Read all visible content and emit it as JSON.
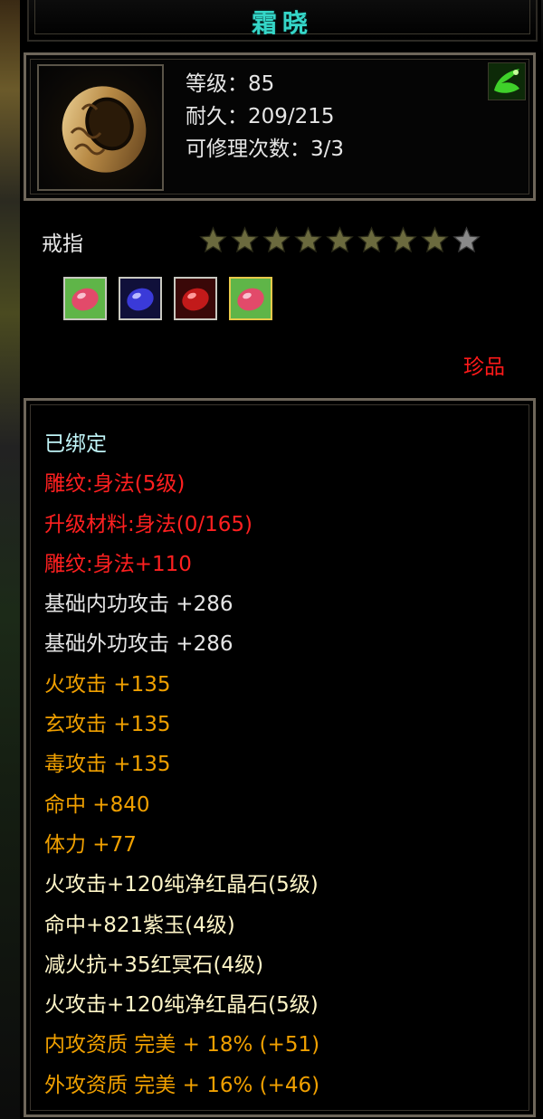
{
  "title": "霜晓",
  "header": {
    "level_label": "等级：85",
    "durability_label": "耐久：209/215",
    "repair_label": "可修理次数：3/3",
    "item_icon": "ring-icon",
    "badge_icon": "green-emblem-icon"
  },
  "item_type": "戒指",
  "stars": {
    "total": 9,
    "filled": 8,
    "filled_color": "#6b6a3e",
    "empty_color": "#8a8a8a"
  },
  "gems": [
    {
      "icon": "gem-red-green-icon",
      "selected": false
    },
    {
      "icon": "gem-blue-icon",
      "selected": false
    },
    {
      "icon": "gem-red-icon",
      "selected": false
    },
    {
      "icon": "gem-red-green-icon",
      "selected": true
    }
  ],
  "rarity": "珍品",
  "colors": {
    "bound": "#bff3f6",
    "red": "#ff2020",
    "white": "#e6e6e6",
    "orange": "#f0a000",
    "title": "#35d6c8",
    "yellow": "#fff6c8"
  },
  "attributes": [
    {
      "text": "已绑定",
      "color": "#bff3f6"
    },
    {
      "text": "雕纹:身法(5级)",
      "color": "#ff2020"
    },
    {
      "text": "升级材料:身法(0/165)",
      "color": "#ff2020"
    },
    {
      "text": "雕纹:身法+110",
      "color": "#ff2020"
    },
    {
      "text": "基础内功攻击 +286",
      "color": "#e6e6e6"
    },
    {
      "text": "基础外功攻击 +286",
      "color": "#e6e6e6"
    },
    {
      "text": "火攻击 +135",
      "color": "#f0a000"
    },
    {
      "text": "玄攻击 +135",
      "color": "#f0a000"
    },
    {
      "text": "毒攻击 +135",
      "color": "#f0a000"
    },
    {
      "text": "命中 +840",
      "color": "#f0a000"
    },
    {
      "text": "体力 +77",
      "color": "#f0a000"
    },
    {
      "text": "火攻击+120纯净红晶石(5级)",
      "color": "#fff6c8"
    },
    {
      "text": "命中+821紫玉(4级)",
      "color": "#fff6c8"
    },
    {
      "text": "减火抗+35红冥石(4级)",
      "color": "#fff6c8"
    },
    {
      "text": "火攻击+120纯净红晶石(5级)",
      "color": "#fff6c8"
    },
    {
      "text": "内攻资质 完美 + 18% (+51)",
      "color": "#f0a000"
    },
    {
      "text": "外攻资质 完美 + 16% (+46)",
      "color": "#f0a000"
    }
  ]
}
